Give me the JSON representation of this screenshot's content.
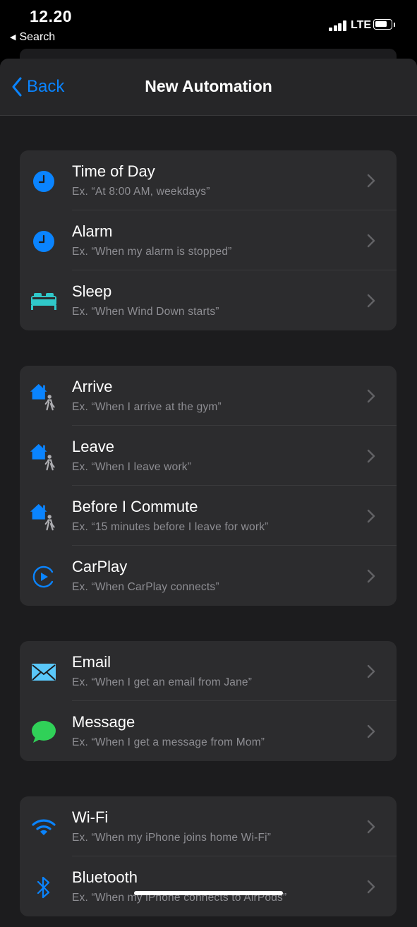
{
  "status_bar": {
    "time": "12.20",
    "back_app": "Search",
    "network": "LTE",
    "signal_bars_filled": 4,
    "battery_level": 0.8
  },
  "nav": {
    "back_label": "Back",
    "title": "New Automation"
  },
  "colors": {
    "accent": "#0a84ff",
    "sleep": "#30c8c9",
    "message": "#30d158",
    "email": "#5ac8fa"
  },
  "groups": [
    {
      "items": [
        {
          "title": "Time of Day",
          "subtitle": "Ex. “At 8:00 AM, weekdays”",
          "icon": "clock-icon"
        },
        {
          "title": "Alarm",
          "subtitle": "Ex. “When my alarm is stopped”",
          "icon": "clock-icon"
        },
        {
          "title": "Sleep",
          "subtitle": "Ex. “When Wind Down starts”",
          "icon": "bed-icon"
        }
      ]
    },
    {
      "items": [
        {
          "title": "Arrive",
          "subtitle": "Ex. “When I arrive at the gym”",
          "icon": "home-person-icon"
        },
        {
          "title": "Leave",
          "subtitle": "Ex. “When I leave work”",
          "icon": "home-person-icon"
        },
        {
          "title": "Before I Commute",
          "subtitle": "Ex. “15 minutes before I leave for work”",
          "icon": "home-person-icon"
        },
        {
          "title": "CarPlay",
          "subtitle": "Ex. “When CarPlay connects”",
          "icon": "carplay-icon"
        }
      ]
    },
    {
      "items": [
        {
          "title": "Email",
          "subtitle": "Ex. “When I get an email from Jane”",
          "icon": "envelope-icon"
        },
        {
          "title": "Message",
          "subtitle": "Ex. “When I get a message from Mom”",
          "icon": "message-bubble-icon"
        }
      ]
    },
    {
      "items": [
        {
          "title": "Wi-Fi",
          "subtitle": "Ex. “When my iPhone joins home Wi-Fi”",
          "icon": "wifi-icon"
        },
        {
          "title": "Bluetooth",
          "subtitle": "Ex. “When my iPhone connects to AirPods”",
          "icon": "bluetooth-icon"
        }
      ]
    }
  ]
}
